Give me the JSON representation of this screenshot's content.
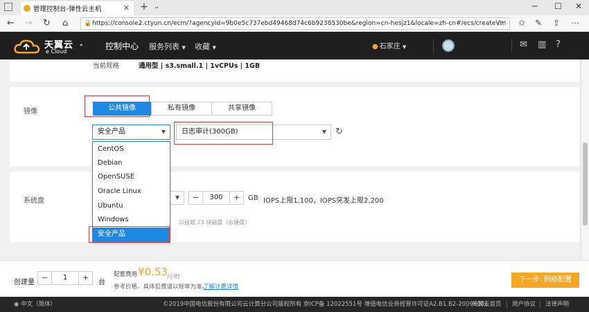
{
  "browser": {
    "tab_title": "管理控制台-弹性云主机",
    "url": "https://console2.ctyun.cn/ecm/?agencyId=9b0e5c737ebd49468d74c6b9238530be&region=cn-hesjz1&locale=zh-cn#/ecs/createVm"
  },
  "header": {
    "logo_text": "天翼云",
    "logo_sub": "e Cloud",
    "nav_console": "控制中心",
    "nav_services": "服务列表",
    "nav_favorites": "收藏",
    "region": "石家庄"
  },
  "spec": {
    "label": "当前规格",
    "value": "通用型 | s3.small.1 | 1vCPUs | 1GB"
  },
  "image": {
    "label": "镜像",
    "tabs": [
      "公共镜像",
      "私有镜像",
      "共享镜像"
    ],
    "os_selected": "安全产品",
    "image_selected": "日志审计(300GB)",
    "os_options": [
      "CentOS",
      "Debian",
      "OpenSUSE",
      "Oracle Linux",
      "Ubuntu",
      "Windows",
      "安全产品"
    ]
  },
  "disk": {
    "label": "系统盘",
    "size": "300",
    "unit": "GB",
    "iops": "IOPS上限1,100，IOPS突发上限2,200",
    "hint": "以挂载 23 块磁盘（云硬盘）"
  },
  "order": {
    "qty_label": "创建量",
    "qty": "1",
    "qty_unit": "台",
    "price_label": "配置费用",
    "price": "¥0.53",
    "price_unit": "/小时",
    "price_note": "参考价格，具体扣费请以账单为准。",
    "price_link": "了解计费详情",
    "next_button": "下一步: 网络配置"
  },
  "footer": {
    "language": "中文（简体）",
    "copyright": "©2019中国电信股份有限公司云计算分公司版权所有  京ICP备 12022551号  增值电信业务经营许可证A2.B1.B2-20090001",
    "links": [
      "天翼云首页",
      "用户协议",
      "法律声明"
    ]
  },
  "colors": {
    "accent": "#1e88e5",
    "highlight": "#e53935",
    "price": "#f5a623"
  }
}
